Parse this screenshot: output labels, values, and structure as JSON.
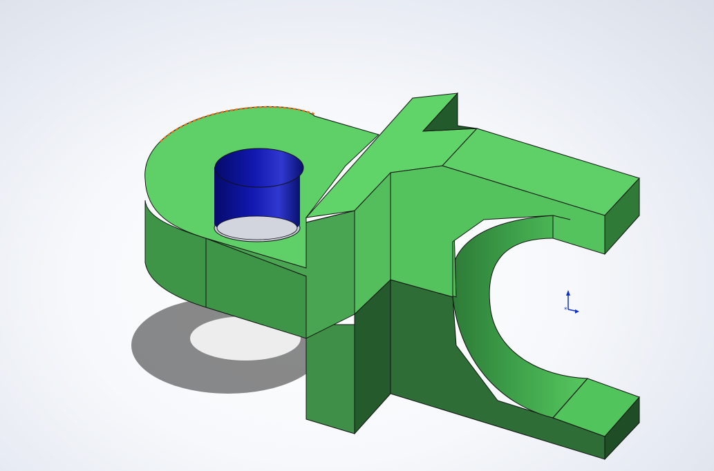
{
  "viewport": {
    "background_top": "#d9dee8",
    "background_center": "#ffffff"
  },
  "model": {
    "part_color": "#57c85f",
    "part_shadow_color": "#245a2c",
    "hole_color": "#0a0f8c",
    "selected_edge_color": "#e8721a",
    "edge_color": "#1a1a1a"
  },
  "triad": {
    "y_axis_color": "#1030c8",
    "x_axis_color": "#1030c8",
    "icon": "origin-triad-icon"
  }
}
